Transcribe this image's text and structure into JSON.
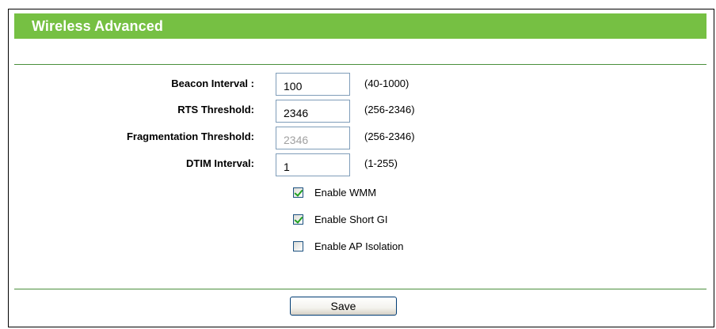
{
  "header": {
    "title": "Wireless Advanced"
  },
  "fields": [
    {
      "label": "Beacon Interval :",
      "value": "100",
      "range": "(40-1000)",
      "disabled": false
    },
    {
      "label": "RTS Threshold:",
      "value": "2346",
      "range": "(256-2346)",
      "disabled": false
    },
    {
      "label": "Fragmentation Threshold:",
      "value": "2346",
      "range": "(256-2346)",
      "disabled": true
    },
    {
      "label": "DTIM Interval:",
      "value": "1",
      "range": "(1-255)",
      "disabled": false
    }
  ],
  "options": [
    {
      "label": "Enable WMM",
      "checked": true
    },
    {
      "label": "Enable Short GI",
      "checked": true
    },
    {
      "label": "Enable AP Isolation",
      "checked": false
    }
  ],
  "actions": {
    "save_label": "Save"
  },
  "colors": {
    "header_bg": "#76c043",
    "divider": "#4a8f3c",
    "check_mark": "#21a121"
  }
}
